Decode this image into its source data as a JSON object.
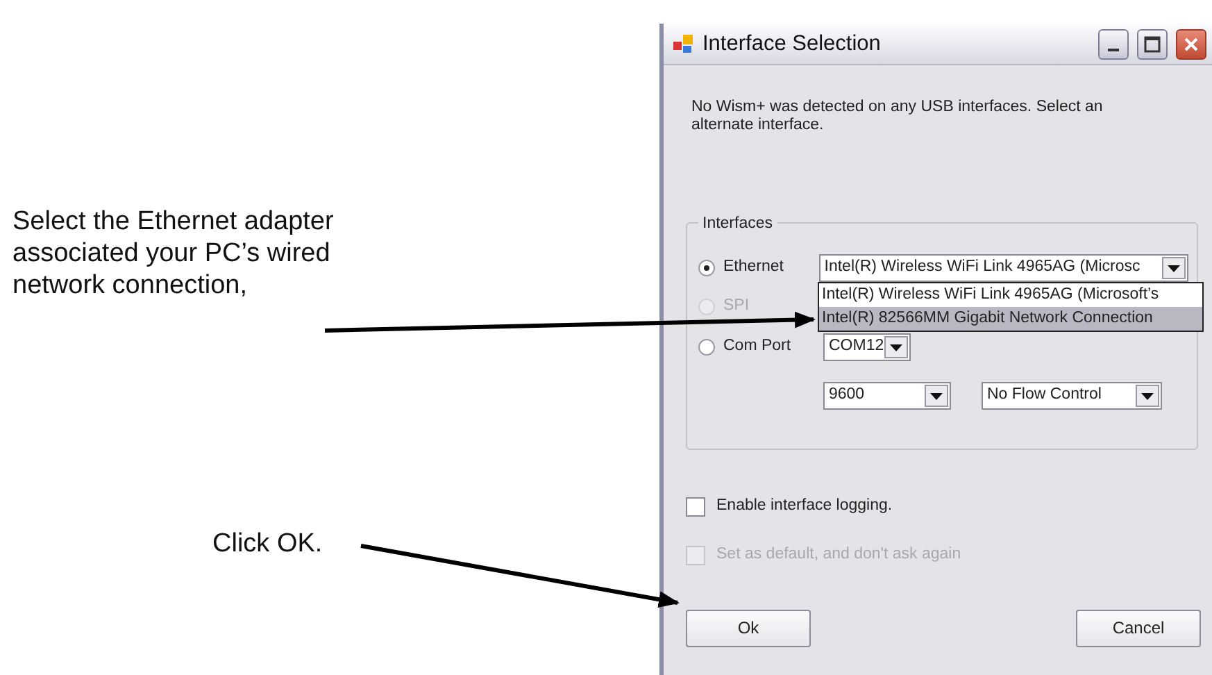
{
  "annotations": [
    {
      "text": "Select the Ethernet adapter associated your PC’s wired network connection,"
    },
    {
      "text": "Click OK."
    }
  ],
  "window": {
    "title": "Interface Selection",
    "message": "No Wism+ was detected on any USB interfaces. Select an alternate interface.",
    "interfaces": {
      "label": "Interfaces",
      "options": [
        {
          "label": "Ethernet",
          "selected": true,
          "disabled": false
        },
        {
          "label": "SPI",
          "selected": false,
          "disabled": true
        },
        {
          "label": "Com Port",
          "selected": false,
          "disabled": false
        }
      ],
      "ethernet_dropdown": {
        "value": "Intel(R) Wireless WiFi Link 4965AG (Microsc",
        "expanded": true,
        "items": [
          {
            "text": "Intel(R) Wireless WiFi Link 4965AG (Microsoft’s",
            "selected": false
          },
          {
            "text": "Intel(R) 82566MM Gigabit Network Connection",
            "selected": true
          }
        ]
      },
      "com_port_dropdown": {
        "value": "COM12"
      },
      "baud_dropdown": {
        "value": "9600"
      },
      "flow_dropdown": {
        "value": "No Flow Control"
      }
    },
    "checkboxes": [
      {
        "label": "Enable interface logging.",
        "checked": false,
        "disabled": false
      },
      {
        "label": "Set as default, and don't ask again",
        "checked": false,
        "disabled": true
      }
    ],
    "buttons": [
      {
        "label": "Ok"
      },
      {
        "label": "Cancel"
      }
    ]
  }
}
